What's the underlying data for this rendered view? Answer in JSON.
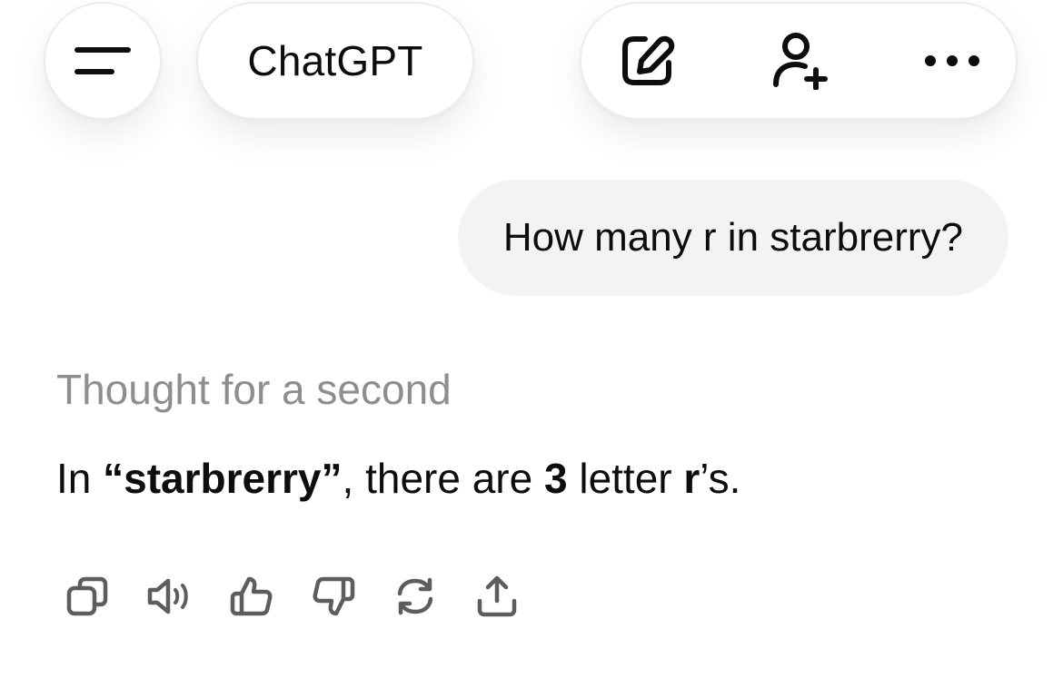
{
  "header": {
    "title": "ChatGPT",
    "icons": {
      "menu": "menu-icon",
      "new_chat": "new-chat-icon",
      "add_user": "add-user-icon",
      "more": "more-icon"
    }
  },
  "conversation": {
    "user_message": "How many r in starbrerry?",
    "thought_label": "Thought for a second",
    "answer": {
      "prefix": "In ",
      "word": "“starbrerry”",
      "middle": ", there are ",
      "count": "3",
      "after_count": " letter ",
      "letter": "r",
      "suffix": "’s."
    }
  },
  "message_actions": [
    "copy-icon",
    "read-aloud-icon",
    "thumbs-up-icon",
    "thumbs-down-icon",
    "regenerate-icon",
    "share-icon"
  ],
  "colors": {
    "background": "#ffffff",
    "bubble": "#f3f3f3",
    "text": "#0d0d0d",
    "muted": "#8e8e8e",
    "icon": "#5d5d5d"
  }
}
